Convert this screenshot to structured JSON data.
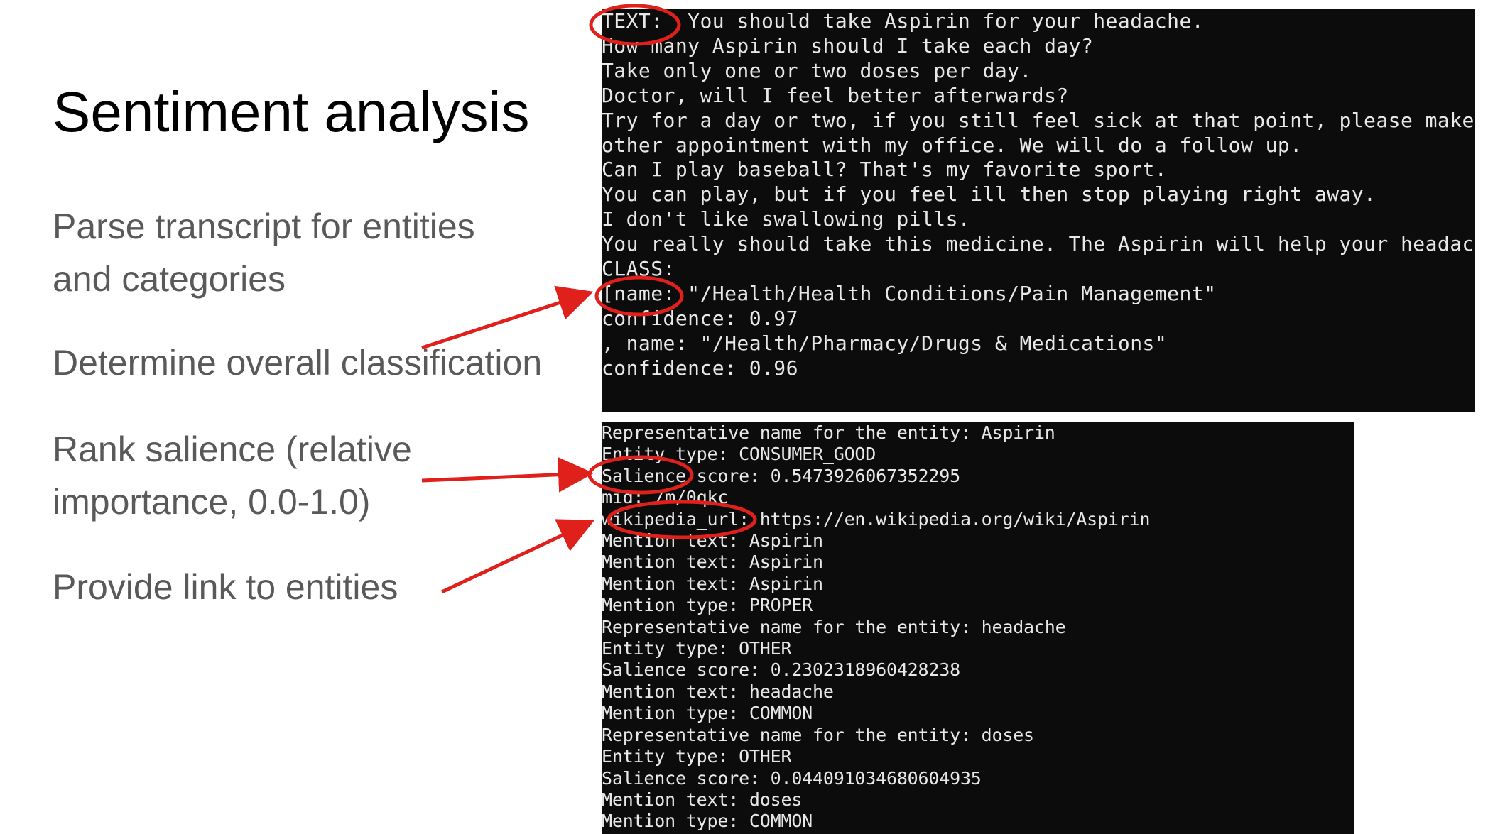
{
  "slide": {
    "title": "Sentiment analysis",
    "bullets": [
      [
        "Parse transcript for entities",
        "and categories"
      ],
      [
        "Determine overall classification"
      ],
      [
        "Rank salience (relative",
        "importance, 0.0-1.0)"
      ],
      [
        "Provide link to entities"
      ]
    ]
  },
  "colors": {
    "accent": "#e0201b",
    "terminal_bg": "#0c0c0c",
    "terminal_text": "#e8e8e8",
    "bullet_text": "#595959"
  },
  "terminal_top": {
    "lines": [
      "TEXT:  You should take Aspirin for your headache.",
      "How many Aspirin should I take each day?",
      "Take only one or two doses per day.",
      "Doctor, will I feel better afterwards?",
      "Try for a day or two, if you still feel sick at that point, please make an",
      "other appointment with my office. We will do a follow up.",
      "Can I play baseball? That's my favorite sport.",
      "You can play, but if you feel ill then stop playing right away.",
      "I don't like swallowing pills.",
      "You really should take this medicine. The Aspirin will help your headache.",
      "",
      "CLASS:",
      "[name: \"/Health/Health Conditions/Pain Management\"",
      "confidence: 0.97",
      ", name: \"/Health/Pharmacy/Drugs & Medications\"",
      "confidence: 0.96"
    ]
  },
  "terminal_bottom": {
    "lines": [
      "Representative name for the entity: Aspirin",
      "Entity type: CONSUMER_GOOD",
      "Salience score: 0.5473926067352295",
      "mid: /m/0qkc",
      "wikipedia_url: https://en.wikipedia.org/wiki/Aspirin",
      "Mention text: Aspirin",
      "Mention text: Aspirin",
      "Mention text: Aspirin",
      "Mention type: PROPER",
      "Representative name for the entity: headache",
      "Entity type: OTHER",
      "Salience score: 0.2302318960428238",
      "Mention text: headache",
      "Mention type: COMMON",
      "Representative name for the entity: doses",
      "Entity type: OTHER",
      "Salience score: 0.044091034680604935",
      "Mention text: doses",
      "Mention type: COMMON"
    ]
  }
}
